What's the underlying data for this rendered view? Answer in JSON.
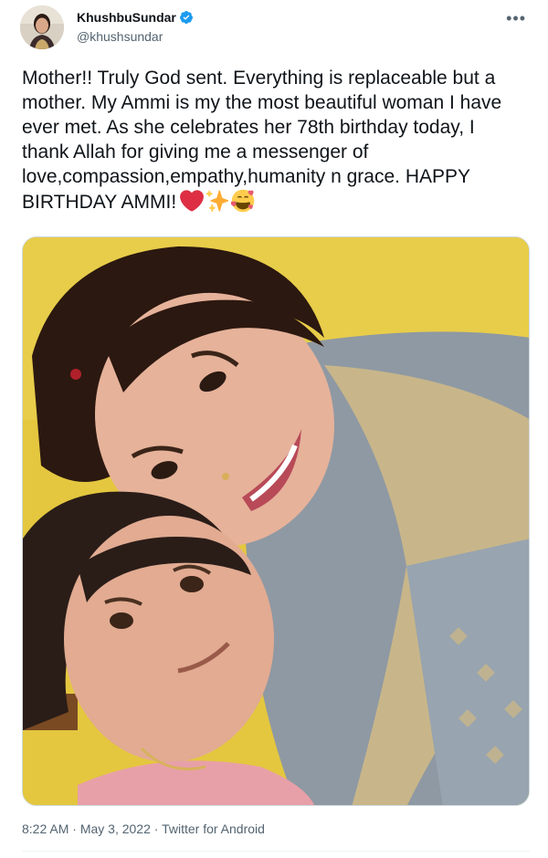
{
  "author": {
    "display_name": "KhushbuSundar",
    "handle": "@khushsundar",
    "verified": true,
    "verified_color": "#1d9bf0"
  },
  "more_label": "•••",
  "tweet": {
    "text": "Mother!! Truly God sent. Everything is replaceable but a mother. My Ammi is my the most beautiful woman I have ever met. As she celebrates her 78th birthday today, I thank Allah for giving me a messenger of love,compassion,empathy,humanity n grace. HAPPY BIRTHDAY AMMI!",
    "emojis": [
      "red-heart-icon",
      "sparkles-icon",
      "smiling-face-with-hearts-icon"
    ]
  },
  "media": {
    "background_color": "#e4c73f"
  },
  "meta": {
    "time": "8:22 AM",
    "date": "May 3, 2022",
    "source": "Twitter for Android"
  },
  "colors": {
    "text": "#0f1419",
    "secondary": "#536471",
    "border": "#cfd9de"
  }
}
